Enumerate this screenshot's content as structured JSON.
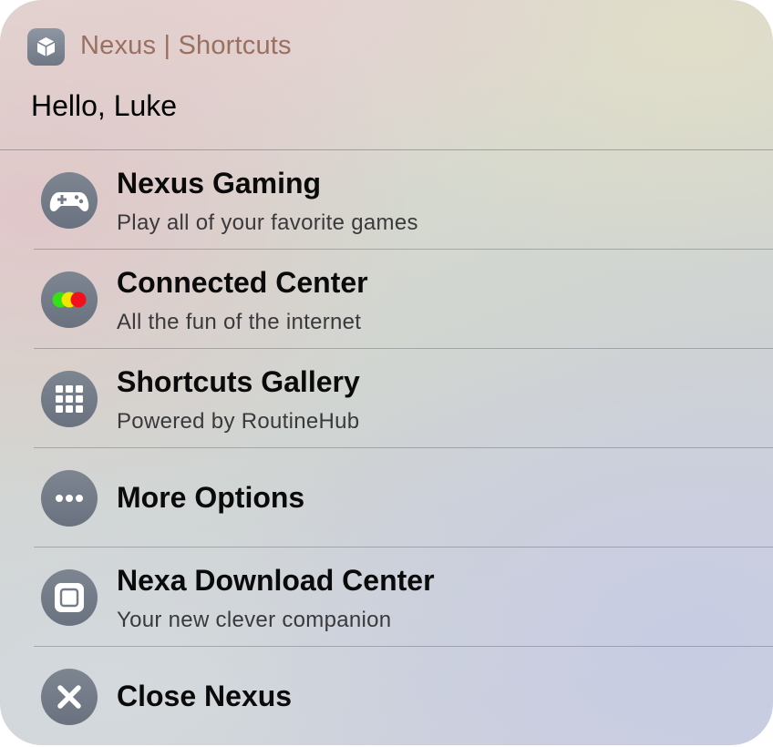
{
  "header": {
    "app_title": "Nexus | Shortcuts",
    "app_icon": "cube-icon",
    "greeting": "Hello, Luke"
  },
  "menu": {
    "items": [
      {
        "title": "Nexus Gaming",
        "subtitle": "Play all of your favorite games",
        "icon": "gamepad-icon"
      },
      {
        "title": "Connected Center",
        "subtitle": "All the fun of the internet",
        "icon": "traffic-dots-icon"
      },
      {
        "title": "Shortcuts Gallery",
        "subtitle": "Powered by RoutineHub",
        "icon": "grid-icon"
      },
      {
        "title": "More Options",
        "icon": "ellipsis-icon"
      },
      {
        "title": "Nexa Download Center",
        "subtitle": "Your new clever companion",
        "icon": "square-icon"
      },
      {
        "title": "Close Nexus",
        "icon": "close-icon"
      }
    ]
  },
  "colors": {
    "title_accent": "#9a7060",
    "icon_circle": "#747c89",
    "dot_green": "#34e018",
    "dot_yellow": "#f2e600",
    "dot_red": "#f2101c"
  }
}
